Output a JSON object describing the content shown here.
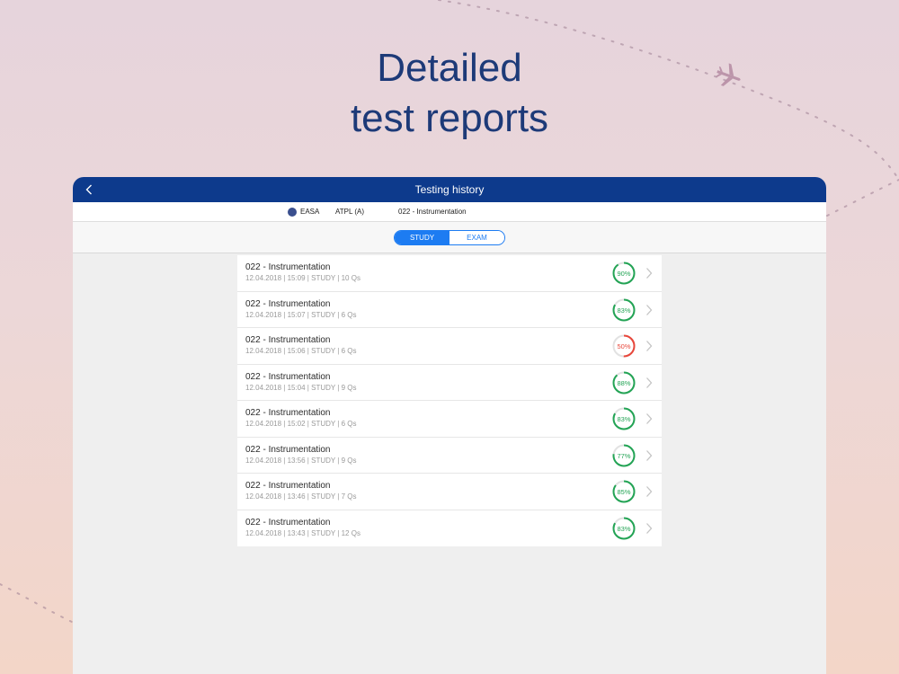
{
  "headline": {
    "line1": "Detailed",
    "line2": "test reports"
  },
  "navbar": {
    "title": "Testing history"
  },
  "infobar": {
    "authority": "EASA",
    "license": "ATPL (A)",
    "subject": "022 - Instrumentation"
  },
  "tabs": {
    "study": "STUDY",
    "exam": "EXAM",
    "active": "study"
  },
  "colors": {
    "pass": "#23a455",
    "fail": "#e8473b",
    "nav": "#0d3a8c",
    "accent": "#1d7cf2"
  },
  "history": [
    {
      "title": "022 - Instrumentation",
      "subtitle": "12.04.2018 | 15:09 | STUDY | 10 Qs",
      "score": 90,
      "score_label": "90%",
      "status": "pass"
    },
    {
      "title": "022 - Instrumentation",
      "subtitle": "12.04.2018 | 15:07 | STUDY | 6 Qs",
      "score": 83,
      "score_label": "83%",
      "status": "pass"
    },
    {
      "title": "022 - Instrumentation",
      "subtitle": "12.04.2018 | 15:06 | STUDY | 6 Qs",
      "score": 50,
      "score_label": "50%",
      "status": "fail"
    },
    {
      "title": "022 - Instrumentation",
      "subtitle": "12.04.2018 | 15:04 | STUDY | 9 Qs",
      "score": 88,
      "score_label": "88%",
      "status": "pass"
    },
    {
      "title": "022 - Instrumentation",
      "subtitle": "12.04.2018 | 15:02 | STUDY | 6 Qs",
      "score": 83,
      "score_label": "83%",
      "status": "pass"
    },
    {
      "title": "022 - Instrumentation",
      "subtitle": "12.04.2018 | 13:56 | STUDY | 9 Qs",
      "score": 77,
      "score_label": "77%",
      "status": "pass"
    },
    {
      "title": "022 - Instrumentation",
      "subtitle": "12.04.2018 | 13:46 | STUDY | 7 Qs",
      "score": 85,
      "score_label": "85%",
      "status": "pass"
    },
    {
      "title": "022 - Instrumentation",
      "subtitle": "12.04.2018 | 13:43 | STUDY | 12 Qs",
      "score": 83,
      "score_label": "83%",
      "status": "pass"
    }
  ]
}
